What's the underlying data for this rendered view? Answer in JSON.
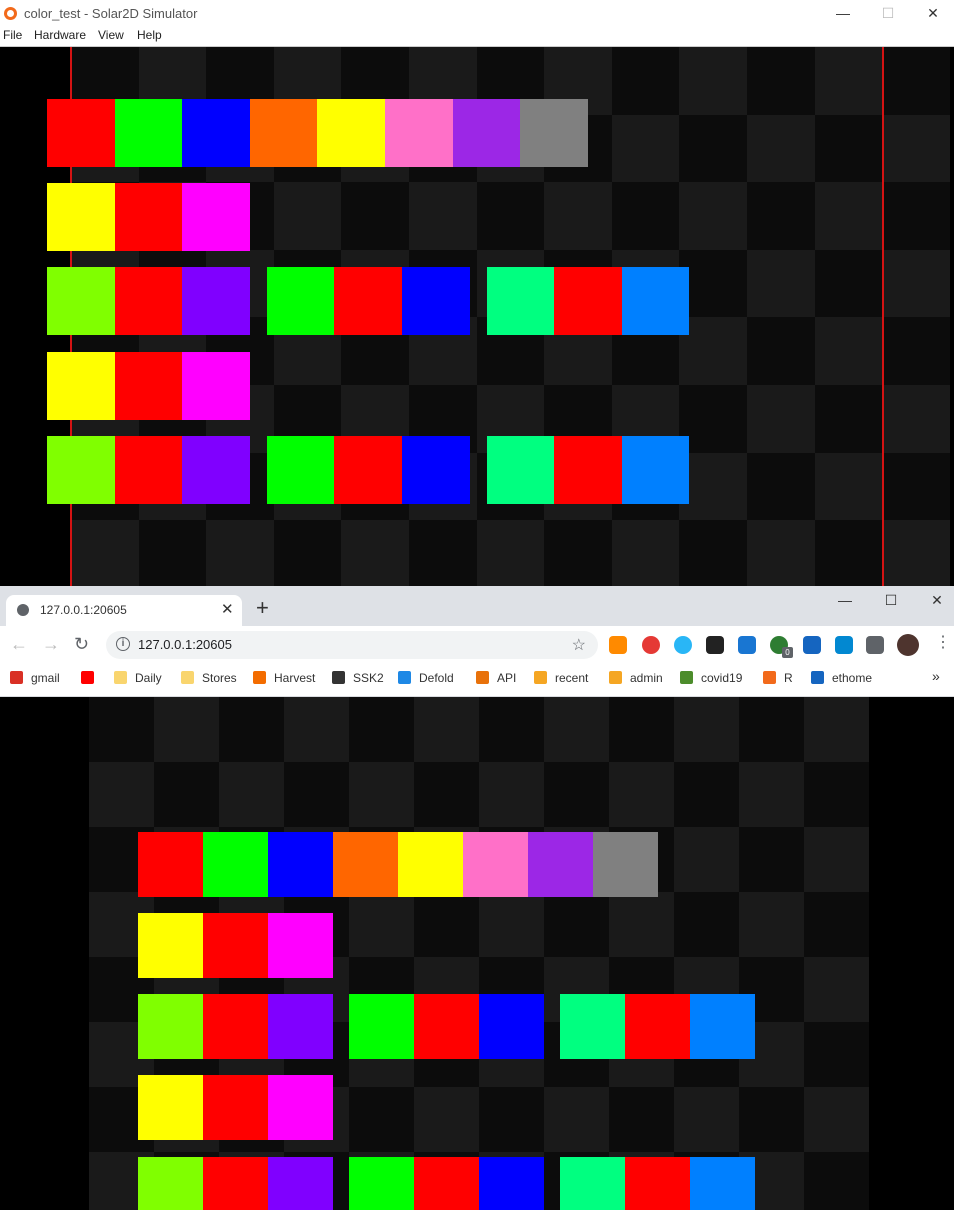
{
  "simulator": {
    "title": "color_test - Solar2D Simulator",
    "controls": {
      "minimize": "—",
      "maximize": "☐",
      "close": "✕"
    },
    "menu": [
      "File",
      "Hardware",
      "View",
      "Help"
    ]
  },
  "browser": {
    "tab_title": "127.0.0.1:20605",
    "tab_close": "✕",
    "new_tab": "+",
    "controls": {
      "minimize": "—",
      "maximize": "☐",
      "close": "✕"
    },
    "url": "127.0.0.1:20605",
    "bookmarks": [
      {
        "label": "gmail",
        "icon": "gmail-icon",
        "color": "#d93025"
      },
      {
        "label": "",
        "icon": "youtube-icon",
        "color": "#ff0000"
      },
      {
        "label": "Daily",
        "icon": "folder-icon",
        "color": "#f9d56e"
      },
      {
        "label": "Stores",
        "icon": "folder-icon",
        "color": "#f9d56e"
      },
      {
        "label": "Harvest",
        "icon": "harvest-icon",
        "color": "#f36c00"
      },
      {
        "label": "SSK2",
        "icon": "book-icon",
        "color": "#333333"
      },
      {
        "label": "Defold",
        "icon": "defold-icon",
        "color": "#1e88e5"
      },
      {
        "label": "API",
        "icon": "list-icon",
        "color": "#e8710a"
      },
      {
        "label": "recent",
        "icon": "corona-icon",
        "color": "#f5a623"
      },
      {
        "label": "admin",
        "icon": "corona-icon",
        "color": "#f5a623"
      },
      {
        "label": "covid19",
        "icon": "leaf-icon",
        "color": "#4c8c2b"
      },
      {
        "label": "R",
        "icon": "r-icon",
        "color": "#f26a1b"
      },
      {
        "label": "ethome",
        "icon": "dsm-icon",
        "color": "#1565c0"
      }
    ],
    "more_bookmarks": "»",
    "extension_badge": "0"
  },
  "palette_rows": [
    [
      "#ff0000",
      "#00ff00",
      "#0000ff",
      "#ff6600",
      "#ffff00",
      "#ff70c8",
      "#9c27e6",
      "#808080"
    ],
    [
      "#ffff00",
      "#ff0000",
      "#ff00ff"
    ],
    [
      [
        "#80ff00",
        "#ff0000",
        "#8000ff"
      ],
      [
        "#00ff00",
        "#ff0000",
        "#0000ff"
      ],
      [
        "#00ff80",
        "#ff0000",
        "#0080ff"
      ]
    ],
    [
      "#ffff00",
      "#ff0000",
      "#ff00ff"
    ],
    [
      [
        "#80ff00",
        "#ff0000",
        "#8000ff"
      ],
      [
        "#00ff00",
        "#ff0000",
        "#0000ff"
      ],
      [
        "#00ff80",
        "#ff0000",
        "#0080ff"
      ]
    ]
  ],
  "colors": {
    "checker_dark": "#0c0c0c",
    "checker_light": "#1a1a1a",
    "guide_line": "#d41313"
  }
}
